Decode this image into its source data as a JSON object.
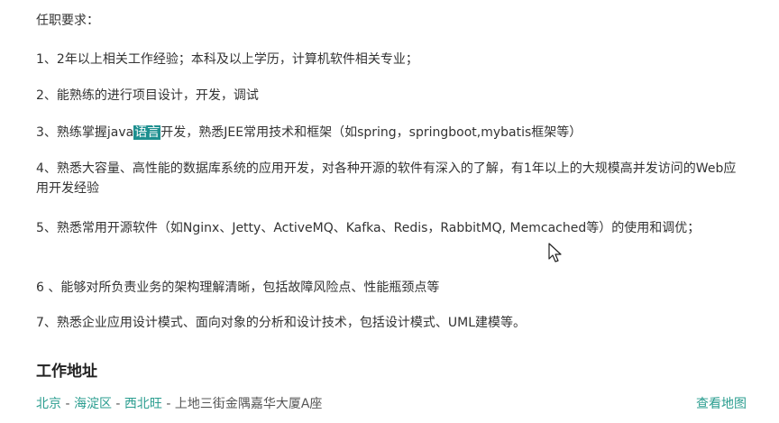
{
  "requirements": {
    "title": "任职要求：",
    "items": [
      {
        "text": "1、2年以上相关工作经验；本科及以上学历，计算机软件相关专业；"
      },
      {
        "text": "2、能熟练的进行项目设计，开发，调试"
      },
      {
        "before": "3、熟练掌握java",
        "highlight": "语言",
        "after": "开发，熟悉JEE常用技术和框架（如spring，springboot,mybatis框架等）"
      },
      {
        "text": "4、熟悉大容量、高性能的数据库系统的应用开发，对各种开源的软件有深入的了解，有1年以上的大规模高并发访问的Web应用开发经验"
      },
      {
        "text": "5、熟悉常用开源软件（如Nginx、Jetty、ActiveMQ、Kafka、Redis，RabbitMQ, Memcached等）的使用和调优；"
      },
      {
        "text": "6 、能够对所负责业务的架构理解清晰，包括故障风险点、性能瓶颈点等"
      },
      {
        "text": "7、熟悉企业应用设计模式、面向对象的分析和设计技术，包括设计模式、UML建模等。"
      }
    ]
  },
  "work_location": {
    "title": "工作地址",
    "city": "北京",
    "district": "海淀区",
    "area": "西北旺",
    "separator": " - ",
    "detail": "上地三街金隅嘉华大厦A座",
    "map_link": "查看地图"
  },
  "colors": {
    "link": "#2a9d8f",
    "highlight_bg": "#1d8f8f",
    "text": "#333333"
  },
  "icons": {
    "cursor": "mouse-pointer-arrow"
  }
}
